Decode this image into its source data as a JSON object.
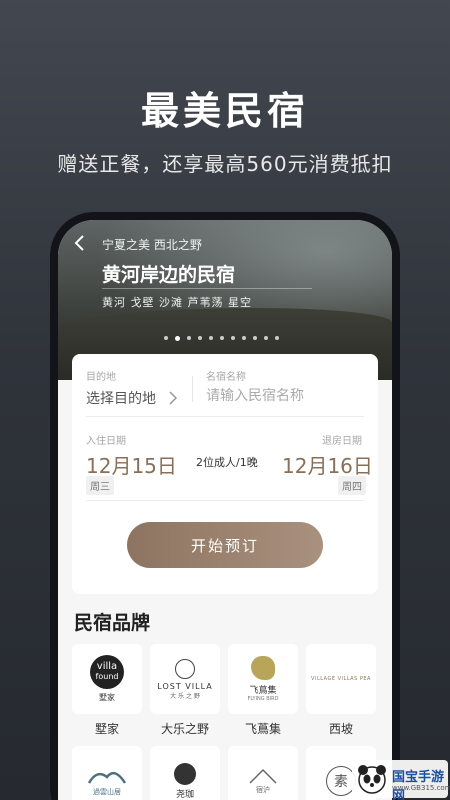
{
  "promo": {
    "headline": "最美民宿",
    "subline": "赠送正餐，还享最高560元消费抵扣"
  },
  "hero": {
    "tag": "宁夏之美 西北之野",
    "title": "黄河岸边的民宿",
    "subtitle": "黄河 戈壁 沙滩 芦苇荡 星空",
    "slide_count": 11,
    "active_slide": 1
  },
  "search": {
    "destination_label": "目的地",
    "destination_value": "选择目的地",
    "name_label": "名宿名称",
    "name_placeholder": "请输入民宿名称",
    "checkin_label": "入住日期",
    "checkin_date": "12月15日",
    "checkin_weekday": "周三",
    "guests": "2位成人/1晚",
    "checkout_label": "退房日期",
    "checkout_date": "12月16日",
    "checkout_weekday": "周四",
    "start_button": "开始预订"
  },
  "brands_section": {
    "title": "民宿品牌",
    "items": [
      {
        "name": "墅家",
        "logo_text": "villa",
        "logo_sub": "found",
        "logo_caption": "墅家"
      },
      {
        "name": "大乐之野",
        "logo_text": "LOST VILLA",
        "logo_caption": "大 乐 之 野"
      },
      {
        "name": "飞蔦集",
        "logo_text": "飞蔦集",
        "logo_caption": "FLYING BIRD"
      },
      {
        "name": "西坡",
        "logo_text": "VILLAGE VILLAS PEA"
      }
    ],
    "second_row": [
      {
        "logo_caption": "過雲山居"
      },
      {
        "logo_text": "尧珈"
      },
      {
        "logo_text": "宿沪"
      },
      {
        "logo_text": "素"
      }
    ]
  },
  "watermark": {
    "text": "国宝手游网",
    "url": "www.GB315.com"
  },
  "colors": {
    "accent": "#8e7460",
    "date_text": "#8a6f58",
    "background_top": "#43474f"
  }
}
